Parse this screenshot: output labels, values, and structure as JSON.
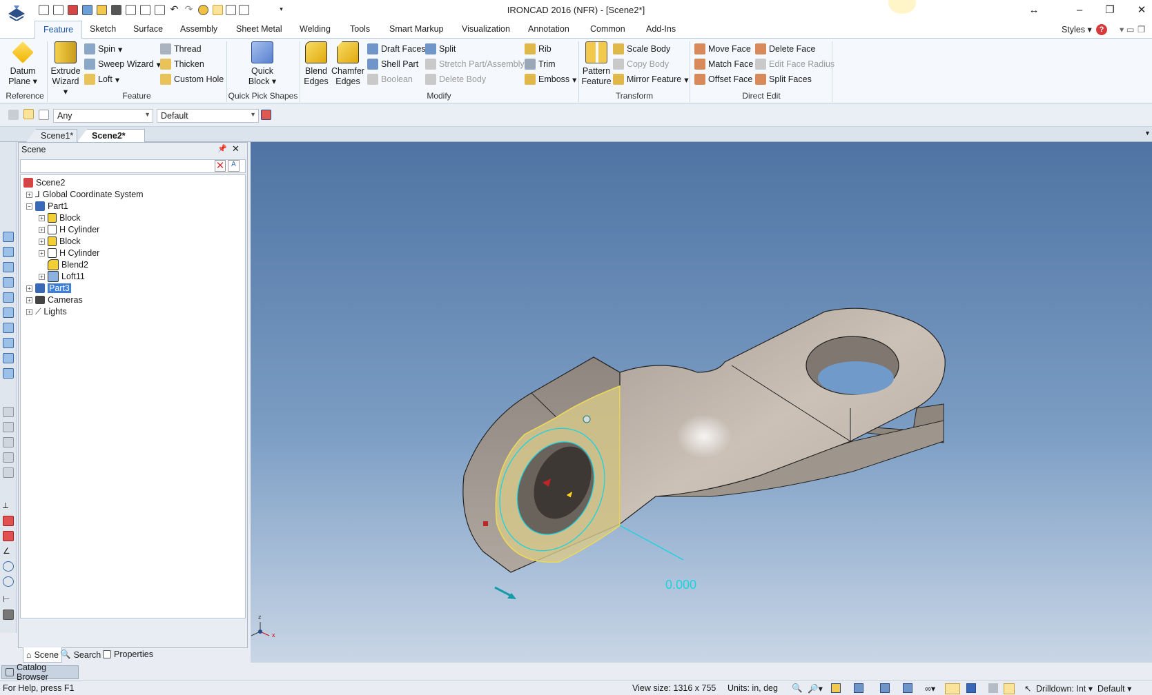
{
  "app": {
    "title": "IRONCAD 2016 (NFR) - [Scene2*]"
  },
  "ribbon_tabs": [
    "Feature",
    "Sketch",
    "Surface",
    "Assembly",
    "Sheet Metal",
    "Welding",
    "Tools",
    "Smart Markup",
    "Visualization",
    "Annotation",
    "Common",
    "Add-Ins"
  ],
  "styles_label": "Styles",
  "ribbon": {
    "reference": {
      "label": "Reference",
      "datum_plane": [
        "Datum",
        "Plane"
      ]
    },
    "feature": {
      "label": "Feature",
      "extrude_wizard": [
        "Extrude",
        "Wizard"
      ],
      "spin": "Spin",
      "sweep_wizard": "Sweep Wizard",
      "loft": "Loft",
      "thread": "Thread",
      "thicken": "Thicken",
      "custom_hole": "Custom Hole"
    },
    "quick_pick": {
      "label": "Quick Pick Shapes",
      "quick_block": [
        "Quick",
        "Block"
      ]
    },
    "modify": {
      "label": "Modify",
      "blend_edges": [
        "Blend",
        "Edges"
      ],
      "chamfer_edges": [
        "Chamfer",
        "Edges"
      ],
      "draft_faces": "Draft Faces",
      "shell_part": "Shell Part",
      "boolean": "Boolean",
      "split": "Split",
      "stretch": "Stretch Part/Assembly",
      "delete_body": "Delete Body",
      "rib": "Rib",
      "trim": "Trim",
      "emboss": "Emboss"
    },
    "transform": {
      "label": "Transform",
      "pattern_feature": [
        "Pattern",
        "Feature"
      ],
      "scale_body": "Scale Body",
      "copy_body": "Copy Body",
      "mirror_feature": "Mirror Feature"
    },
    "direct_edit": {
      "label": "Direct Edit",
      "move_face": "Move Face",
      "match_face": "Match Face",
      "offset_face": "Offset Face",
      "delete_face": "Delete Face",
      "edit_face_radius": "Edit Face Radius",
      "split_faces": "Split Faces"
    }
  },
  "selection_bar": {
    "filter": "Any",
    "style": "Default"
  },
  "doc_tabs": [
    "Scene1*",
    "Scene2*"
  ],
  "scene_panel": {
    "title": "Scene",
    "tree": [
      {
        "label": "Scene2"
      },
      {
        "label": "Global Coordinate System"
      },
      {
        "label": "Part1"
      },
      {
        "label": "Block"
      },
      {
        "label": "H Cylinder"
      },
      {
        "label": "Block"
      },
      {
        "label": "H Cylinder"
      },
      {
        "label": "Blend2"
      },
      {
        "label": "Loft11"
      },
      {
        "label": "Part3"
      },
      {
        "label": "Cameras"
      },
      {
        "label": "Lights"
      }
    ],
    "bottom_tabs": [
      "Scene",
      "Search",
      "Properties"
    ]
  },
  "catalog_browser": "Catalog Browser",
  "viewport": {
    "dimension_value": "0.000",
    "triad": {
      "x": "x",
      "y": "y",
      "z": "z"
    }
  },
  "status": {
    "help": "For Help, press F1",
    "view_size": "View size: 1316 x  755",
    "units": "Units: in, deg",
    "drilldown": "Drilldown: Int",
    "style": "Default"
  },
  "colors": {
    "accent": "#1e5aa8",
    "selection": "#3d7fd8",
    "viewport_top": "#4f74a3",
    "part": "#bdb3a9",
    "highlight_face": "#e9d89a",
    "cyan": "#19d3e0"
  }
}
